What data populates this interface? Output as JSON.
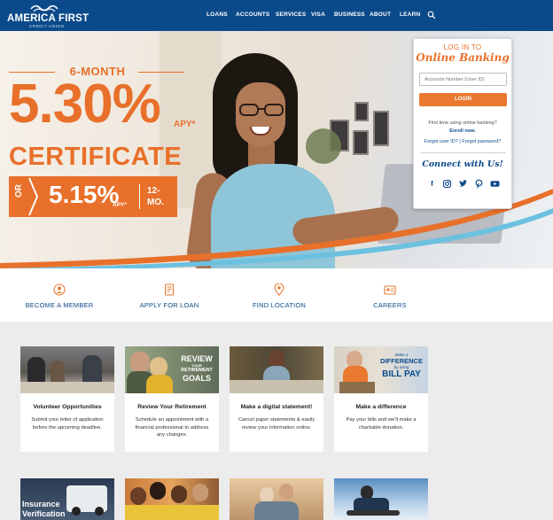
{
  "brand": {
    "name": "AMERICA FIRST",
    "subname": "CREDIT UNION"
  },
  "nav": {
    "items": [
      "LOANS",
      "ACCOUNTS",
      "SERVICES",
      "VISA",
      "BUSINESS",
      "ABOUT",
      "LEARN"
    ],
    "search_icon": "search-icon"
  },
  "colors": {
    "navy": "#0b4a8a",
    "orange": "#e8702a",
    "light_blue": "#6cc0e0",
    "page_gray": "#ececec"
  },
  "hero": {
    "term": "6-MONTH",
    "rate": "5.30%",
    "rate_suffix": "APY*",
    "product": "CERTIFICATE",
    "alt_prefix": "OR",
    "alt_rate": "5.15%",
    "alt_suffix": "APY*",
    "alt_term_line1": "12-",
    "alt_term_line2": "MO."
  },
  "login": {
    "heading": "LOG IN TO",
    "heading_script": "Online Banking",
    "account_placeholder": "Accounts Number (User ID)",
    "button": "LOGIN",
    "first_time": "First time using online banking?",
    "enroll": "Enroll now.",
    "forgot_user": "Forgot user ID?",
    "separator": "|",
    "forgot_password": "Forgot password?",
    "connect": "Connect with Us!",
    "socials": [
      "facebook-icon",
      "instagram-icon",
      "twitter-icon",
      "pinterest-icon",
      "youtube-icon"
    ]
  },
  "quick_links": [
    {
      "label": "BECOME A MEMBER",
      "icon": "member-icon"
    },
    {
      "label": "APPLY FOR LOAN",
      "icon": "loan-icon"
    },
    {
      "label": "FIND LOCATION",
      "icon": "location-icon"
    },
    {
      "label": "CAREERS",
      "icon": "careers-icon"
    }
  ],
  "cards": [
    {
      "title": "Volunteer Opportunities",
      "text": "Submit your letter of application before the upcoming deadline."
    },
    {
      "title": "Review Your Retirement",
      "text": "Schedule an appointment with a financial professional to address any changes.",
      "image_text_1": "REVIEW",
      "image_text_2": "YOUR",
      "image_text_3": "RETIREMENT",
      "image_text_4": "GOALS"
    },
    {
      "title": "Make a digital statement!",
      "text": "Cancel paper statements & easily review your information online."
    },
    {
      "title": "Make a difference",
      "text": "Pay your bills and we'll make a charitable donation.",
      "image_text_1": "Make a",
      "image_text_2": "DIFFERENCE",
      "image_text_3": "by using",
      "image_text_4": "BILL PAY"
    }
  ],
  "cards_row2": [
    {
      "image_text_1": "Insurance",
      "image_text_2": "Verification"
    }
  ]
}
